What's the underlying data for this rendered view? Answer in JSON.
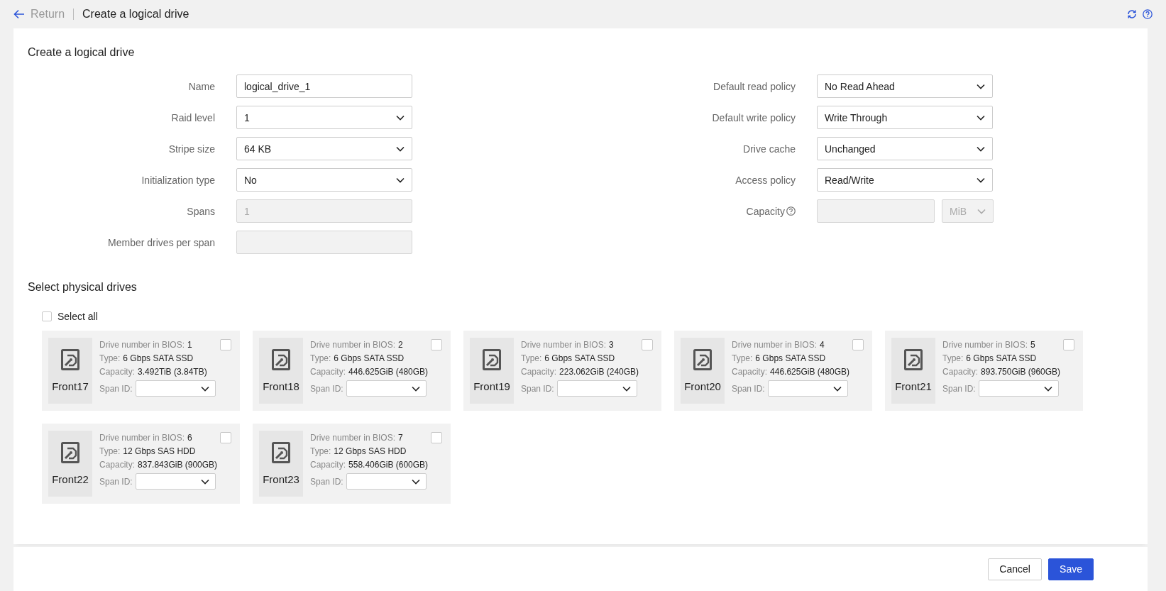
{
  "header": {
    "back_label": "Return",
    "title": "Create a logical drive"
  },
  "form": {
    "title": "Create a logical drive",
    "left_fields": [
      {
        "label": "Name",
        "kind": "input",
        "value": "logical_drive_1",
        "disabled": false
      },
      {
        "label": "Raid level",
        "kind": "select",
        "value": "1",
        "disabled": false
      },
      {
        "label": "Stripe size",
        "kind": "select",
        "value": "64 KB",
        "disabled": false
      },
      {
        "label": "Initialization type",
        "kind": "select",
        "value": "No",
        "disabled": false
      },
      {
        "label": "Spans",
        "kind": "input",
        "value": "1",
        "disabled": true
      },
      {
        "label": "Member drives per span",
        "kind": "input",
        "disabled": true
      }
    ],
    "right_fields": [
      {
        "label": "Default read policy",
        "kind": "select",
        "value": "No Read Ahead",
        "disabled": false
      },
      {
        "label": "Default write policy",
        "kind": "select",
        "value": "Write Through",
        "disabled": false
      },
      {
        "label": "Drive cache",
        "kind": "select",
        "value": "Unchanged",
        "disabled": false
      },
      {
        "label": "Access policy",
        "kind": "select",
        "value": "Read/Write",
        "disabled": false
      },
      {
        "label": "Capacity",
        "kind": "input_unit",
        "help": true,
        "disabled": true,
        "unit": {
          "value": "MiB",
          "disabled": true
        }
      }
    ]
  },
  "drives_section": {
    "title": "Select physical drives",
    "select_all": {
      "label": "Select all",
      "checked": false
    },
    "drives": [
      {
        "name": "Front17",
        "checked": false,
        "fields": [
          {
            "label": "Drive number in BIOS:",
            "value": "1"
          },
          {
            "label": "Type:",
            "value": "6 Gbps SATA SSD"
          },
          {
            "label": "Capacity:",
            "value": "3.492TiB (3.84TB)"
          }
        ],
        "span_label": "Span ID:"
      },
      {
        "name": "Front18",
        "checked": false,
        "fields": [
          {
            "label": "Drive number in BIOS:",
            "value": "2"
          },
          {
            "label": "Type:",
            "value": "6 Gbps SATA SSD"
          },
          {
            "label": "Capacity:",
            "value": "446.625GiB (480GB)"
          }
        ],
        "span_label": "Span ID:"
      },
      {
        "name": "Front19",
        "checked": false,
        "fields": [
          {
            "label": "Drive number in BIOS:",
            "value": "3"
          },
          {
            "label": "Type:",
            "value": "6 Gbps SATA SSD"
          },
          {
            "label": "Capacity:",
            "value": "223.062GiB (240GB)"
          }
        ],
        "span_label": "Span ID:"
      },
      {
        "name": "Front20",
        "checked": false,
        "fields": [
          {
            "label": "Drive number in BIOS:",
            "value": "4"
          },
          {
            "label": "Type:",
            "value": "6 Gbps SATA SSD"
          },
          {
            "label": "Capacity:",
            "value": "446.625GiB (480GB)"
          }
        ],
        "span_label": "Span ID:"
      },
      {
        "name": "Front21",
        "checked": false,
        "fields": [
          {
            "label": "Drive number in BIOS:",
            "value": "5"
          },
          {
            "label": "Type:",
            "value": "6 Gbps SATA SSD"
          },
          {
            "label": "Capacity:",
            "value": "893.750GiB (960GB)"
          }
        ],
        "span_label": "Span ID:"
      },
      {
        "name": "Front22",
        "checked": false,
        "fields": [
          {
            "label": "Drive number in BIOS:",
            "value": "6"
          },
          {
            "label": "Type:",
            "value": "12 Gbps SAS HDD"
          },
          {
            "label": "Capacity:",
            "value": "837.843GiB (900GB)"
          }
        ],
        "span_label": "Span ID:"
      },
      {
        "name": "Front23",
        "checked": false,
        "fields": [
          {
            "label": "Drive number in BIOS:",
            "value": "7"
          },
          {
            "label": "Type:",
            "value": "12 Gbps SAS HDD"
          },
          {
            "label": "Capacity:",
            "value": "558.406GiB (600GB)"
          }
        ],
        "span_label": "Span ID:"
      }
    ]
  },
  "footer": {
    "buttons": [
      {
        "label": "Cancel",
        "kind": "secondary"
      },
      {
        "label": "Save",
        "kind": "primary"
      }
    ]
  }
}
